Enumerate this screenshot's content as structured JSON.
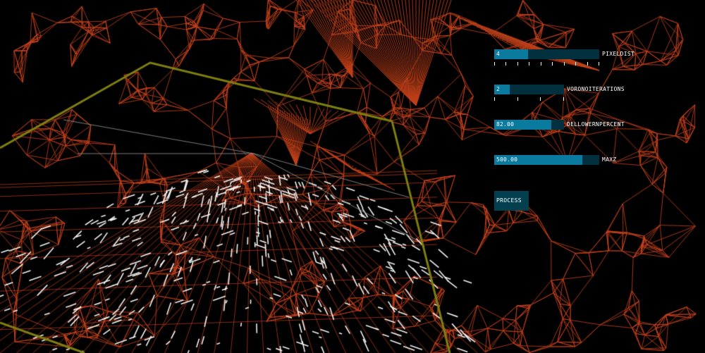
{
  "controls": {
    "pixeldist": {
      "label": "PIXELDIST",
      "value": "4",
      "fraction": 0.32,
      "ticks": 10
    },
    "voronoiterations": {
      "label": "VORONOITERATIONS",
      "value": "2",
      "fraction": 0.22,
      "ticks": 4
    },
    "dellowernpercent": {
      "label": "DELLOWERNPERCENT",
      "value": "82.00",
      "fraction": 0.82
    },
    "maxz": {
      "label": "MAXZ",
      "value": "500.00",
      "fraction": 0.84
    },
    "process": {
      "label": "PROCESS"
    }
  },
  "colors": {
    "background": "#000000",
    "mesh": "#c0401a",
    "frame": "#7f7f10",
    "edges": "#ffffff",
    "slider_track": "#02303f",
    "slider_fill": "#0a7a9e"
  }
}
